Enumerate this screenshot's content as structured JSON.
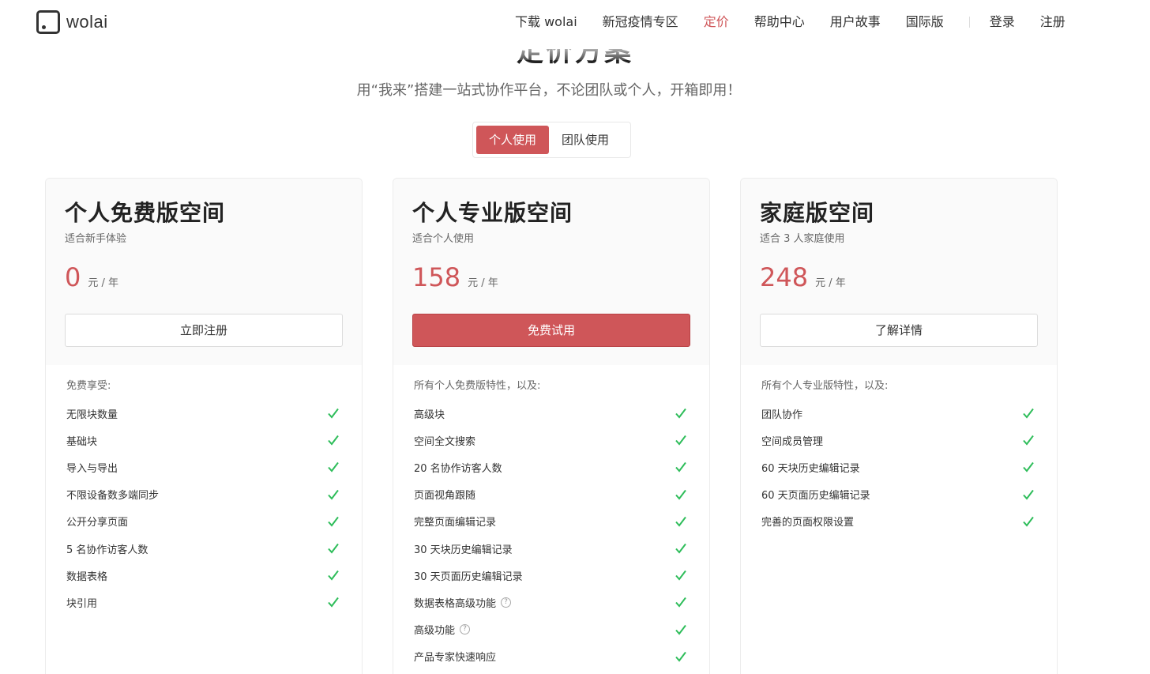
{
  "header": {
    "logo_text": "wolai",
    "nav": [
      {
        "label": "下载 wolai"
      },
      {
        "label": "新冠疫情专区"
      },
      {
        "label": "定价"
      },
      {
        "label": "帮助中心"
      },
      {
        "label": "用户故事"
      },
      {
        "label": "国际版"
      },
      {
        "label": "登录"
      },
      {
        "label": "注册"
      }
    ]
  },
  "hero": {
    "title": "定价方案",
    "subtitle": "用“我来”搭建一站式协作平台，不论团队或个人，开箱即用！"
  },
  "toggle": {
    "options": [
      {
        "label": "个人使用"
      },
      {
        "label": "团队使用"
      }
    ],
    "selected": "个人使用"
  },
  "colors": {
    "accent": "#cf5659",
    "check": "#2ebd5a"
  },
  "plans": [
    {
      "title": "个人免费版空间",
      "desc": "适合新手体验",
      "price": "0",
      "unit": "元 / 年",
      "button": "立即注册",
      "features_head": "免费享受:",
      "features": [
        "无限块数量",
        "基础块",
        "导入与导出",
        "不限设备数多端同步",
        "公开分享页面",
        "5 名协作访客人数",
        "数据表格",
        "块引用"
      ]
    },
    {
      "title": "个人专业版空间",
      "desc": "适合个人使用",
      "price": "158",
      "unit": "元 / 年",
      "button": "免费试用",
      "features_head": "所有个人免费版特性，以及:",
      "features": [
        "高级块",
        "空间全文搜索",
        "20 名协作访客人数",
        "页面视角跟随",
        "完整页面编辑记录",
        "30 天块历史编辑记录",
        "30 天页面历史编辑记录",
        "数据表格高级功能",
        "高级功能",
        "产品专家快速响应"
      ]
    },
    {
      "title": "家庭版空间",
      "desc": "适合 3 人家庭使用",
      "price": "248",
      "unit": "元 / 年",
      "button": "了解详情",
      "features_head": "所有个人专业版特性，以及:",
      "features": [
        "团队协作",
        "空间成员管理",
        "60 天块历史编辑记录",
        "60 天页面历史编辑记录",
        "完善的页面权限设置"
      ]
    }
  ]
}
